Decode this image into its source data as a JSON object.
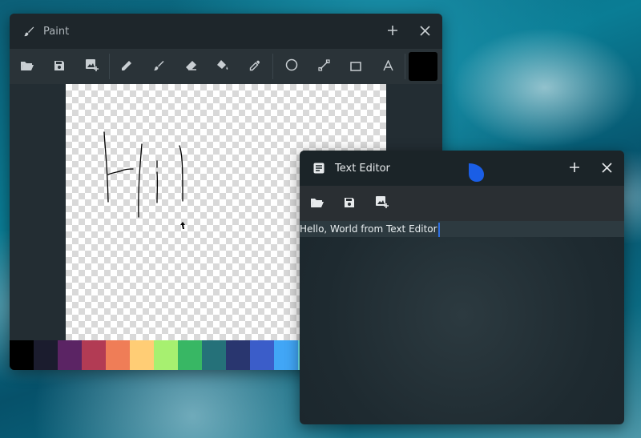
{
  "paint": {
    "title": "Paint",
    "icons": {
      "title": "brush-icon",
      "new": "plus-icon",
      "close": "close-icon",
      "tools": [
        "folder-open-icon",
        "save-icon",
        "image-add-icon",
        "pencil-icon",
        "brush-icon",
        "eraser-icon",
        "fill-bucket-icon",
        "eyedropper-icon",
        "circle-icon",
        "line-icon",
        "rectangle-icon",
        "text-icon"
      ]
    },
    "current_color": "#000000",
    "palette": [
      "#000000",
      "#1b1c2e",
      "#5b2464",
      "#b23b54",
      "#ef7d57",
      "#ffcd75",
      "#a7f070",
      "#38b764",
      "#257179",
      "#29366f",
      "#3b5dc9",
      "#41a6f6",
      "#73eff7"
    ]
  },
  "editor": {
    "title": "Text Editor",
    "text": "Hello, World from Text Editor",
    "icons": {
      "title": "document-icon",
      "new": "plus-icon",
      "close": "close-icon",
      "tools": [
        "folder-open-icon",
        "save-icon",
        "image-add-icon"
      ]
    }
  },
  "colors": {
    "accent": "#2f6fe0",
    "drop": "#1a5ee6"
  }
}
